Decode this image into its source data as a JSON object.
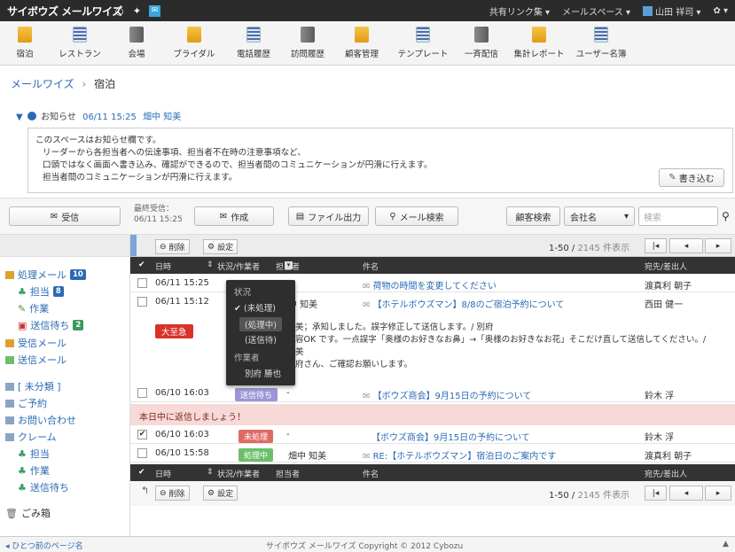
{
  "topbar": {
    "logo": "サイボウズ メールワイズ",
    "shared_links": "共有リンク集 ▾",
    "mail_spaces": "メールスペース ▾",
    "user": "山田 祥司 ▾",
    "gear": "✿ ▾"
  },
  "apps": [
    {
      "label": "宿泊",
      "icon": "bag"
    },
    {
      "label": "レストラン",
      "icon": "doc"
    },
    {
      "label": "会場",
      "icon": "bld"
    },
    {
      "label": "ブライダル",
      "icon": "bag"
    },
    {
      "label": "電話履歴",
      "icon": "doc"
    },
    {
      "label": "訪問履歴",
      "icon": "bld"
    },
    {
      "label": "顧客管理",
      "icon": "bag"
    },
    {
      "label": "テンプレート",
      "icon": "doc"
    },
    {
      "label": "一斉配信",
      "icon": "bld"
    },
    {
      "label": "集計レポート",
      "icon": "bag"
    },
    {
      "label": "ユーザー名簿",
      "icon": "doc"
    }
  ],
  "breadcrumb": {
    "root": "メールワイズ",
    "sep": "›",
    "current": "宿泊"
  },
  "notice": {
    "label": "お知らせ",
    "date": "06/11 15:25",
    "author": "畑中 知美",
    "lines": [
      "このスペースはお知らせ欄です。",
      "リーダーから各担当者への伝達事項、担当者不在時の注意事項など、",
      "口頭ではなく画面へ書き込み、確認ができるので、担当者間のコミュニケーションが円滑に行えます。",
      "担当者間のコミュニケーションが円滑に行えます。"
    ],
    "write": "書き込む"
  },
  "toolbar": {
    "receive": "受信",
    "last_recv_label": "最終受信：",
    "last_recv": "06/11 15:25",
    "compose": "作成",
    "export": "ファイル出力",
    "mail_search": "メール検索",
    "customer_search": "顧客検索",
    "company_select": "会社名",
    "search_placeholder": "検索"
  },
  "sidebar": {
    "processing": "処理メール",
    "processing_count": "10",
    "assigned": "担当",
    "assigned_count": "8",
    "work": "作業",
    "wait": "送信待ち",
    "wait_count": "2",
    "inbox": "受信メール",
    "sent": "送信メール",
    "unclassified": "[ 未分類 ]",
    "reservation": "ご予約",
    "inquiry": "お問い合わせ",
    "claim": "クレーム",
    "claim_assigned": "担当",
    "claim_work": "作業",
    "claim_wait": "送信待ち",
    "trash": "ごみ箱"
  },
  "list": {
    "delete": "削除",
    "settings": "設定",
    "range": "1-50",
    "total": "2145 件表示",
    "columns": {
      "date": "日時",
      "status": "状況/作業者",
      "assignee": "担当者",
      "subject": "件名",
      "from": "宛先/差出人"
    }
  },
  "rows": [
    {
      "checked": "",
      "date": "06/11 15:25",
      "tag": "",
      "tagcolor": "",
      "assignee": "",
      "subject": "荷物の時間を変更してください",
      "from": "渡真利 朝子"
    },
    {
      "checked": "",
      "date": "06/11 15:12",
      "tag": "",
      "tagcolor": "",
      "assignee": "中 知美",
      "subject": "【ホテルボウズマン】8/8のご宿泊予約について",
      "from": "西田 健一"
    },
    {
      "checked": "",
      "date": "06/10 16:03",
      "tag": "送信待ち",
      "tagcolor": "#9b97d6",
      "assignee": "-",
      "subject": "【ボウズ商会】9月15日の予約について",
      "from": "鈴木 浮"
    },
    {
      "checked": "✔",
      "date": "06/10 16:03",
      "tag": "未処理",
      "tagcolor": "#e06a62",
      "assignee": "-",
      "subject": "【ボウズ商会】9月15日の予約について",
      "from": "鈴木 浮"
    },
    {
      "checked": "",
      "date": "06/10 15:58",
      "tag": "処理中",
      "tagcolor": "#6bbf6b",
      "assignee": "畑中 知美",
      "subject": "RE:【ホテルボウズマン】宿泊日のご案内です",
      "from": "渡真利 朝子"
    }
  ],
  "expanded": {
    "urgent": "大至急",
    "lines": [
      "美；承知しました。誤字修正して送信します。/ 別府",
      "容OK です。一点誤字「奥様のお好きなお鼻」→「奥様のお好きなお花」そこだけ直して送信してください。/",
      "美",
      "府さん、ご確認お願いします。"
    ]
  },
  "reminder": "本日中に返信しましょう！",
  "dropdown": {
    "status_label": "状況",
    "opt1": "(未処理)",
    "opt2": "(処理中)",
    "opt3": "(送信待)",
    "worker_label": "作業者",
    "worker": "別府 勝也"
  },
  "footer": {
    "prev": "◂ ひとつ前のページ名",
    "copyright": "サイボウズ メールワイズ Copyright © 2012 Cybozu",
    "top": "▲"
  }
}
